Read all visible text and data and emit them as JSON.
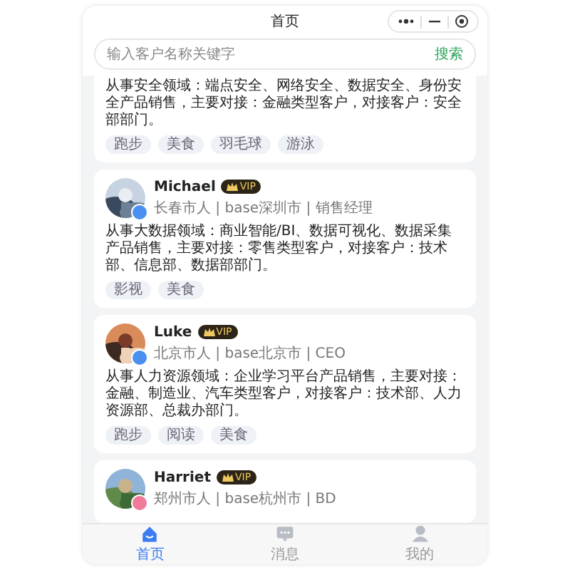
{
  "header": {
    "title": "首页"
  },
  "search": {
    "placeholder": "输入客户名称关键字",
    "button": "搜索"
  },
  "cards": [
    {
      "desc": "从事安全领域：端点安全、网络安全、数据安全、身份安全产品销售，主要对接：金融类型客户，对接客户：安全部部门。",
      "tags": [
        "跑步",
        "美食",
        "羽毛球",
        "游泳"
      ]
    },
    {
      "name": "Michael",
      "badge": "VIP",
      "color": "#4a90f0",
      "meta": "长春市人 | base深圳市 | 销售经理",
      "desc": "从事大数据领域：商业智能/BI、数据可视化、数据采集产品销售，主要对接：零售类型客户，对接客户：技术部、信息部、数据部部门。",
      "tags": [
        "影视",
        "美食"
      ]
    },
    {
      "name": "Luke",
      "badge": "VIP",
      "color": "#4a90f0",
      "meta": "北京市人 | base北京市 | CEO",
      "desc": "从事人力资源领域：企业学习平台产品销售，主要对接：金融、制造业、汽车类型客户，对接客户：技术部、人力资源部、总裁办部门。",
      "tags": [
        "跑步",
        "阅读",
        "美食"
      ]
    },
    {
      "name": "Harriet",
      "badge": "VIP",
      "color": "#f07a9a",
      "meta": "郑州市人 | base杭州市 | BD"
    }
  ],
  "tabs": [
    {
      "label": "首页",
      "kind": "home",
      "selected": true
    },
    {
      "label": "消息",
      "kind": "chat",
      "selected": false
    },
    {
      "label": "我的",
      "kind": "person",
      "selected": false
    }
  ]
}
